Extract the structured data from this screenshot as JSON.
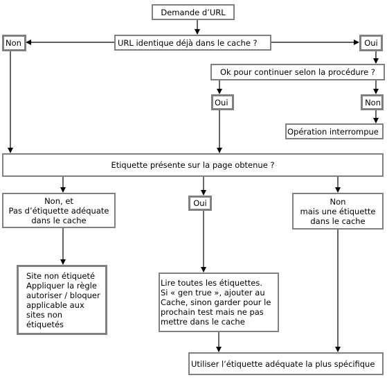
{
  "diagram": {
    "nodes": {
      "start": {
        "label": "Demande d’URL"
      },
      "cache_check": {
        "label": "URL identique déjà dans le cache ?"
      },
      "cache_no": {
        "label": "Non"
      },
      "cache_yes": {
        "label": "Oui"
      },
      "proceed_check": {
        "label": "Ok pour continuer selon la procédure ?"
      },
      "proceed_yes": {
        "label": "Oui"
      },
      "proceed_no": {
        "label": "Non"
      },
      "interrupted": {
        "label": "Opération interrompue"
      },
      "label_present": {
        "label": "Etiquette présente sur la page obtenue ?"
      },
      "no_label_no_cache": {
        "label": "Non, et\nPas d’étiquette adéquate\ndans le cache"
      },
      "label_yes": {
        "label": "Oui"
      },
      "no_but_cache": {
        "label": "Non\nmais une étiquette\ndans le cache"
      },
      "unlabeled_site": {
        "label": "Site non  étiqueté\nAppliquer la règle\nautoriser / bloquer\napplicable aux\nsites non\nétiquetés"
      },
      "read_labels": {
        "label": "Lire toutes les étiquettes.\nSi « gen true », ajouter au\nCache, sinon garder pour le\nprochain test mais ne pas\nmettre dans le cache"
      },
      "use_specific": {
        "label": "Utiliser l’étiquette adéquate la plus spécifique"
      }
    },
    "edges": [
      {
        "from": "start",
        "to": "cache_check"
      },
      {
        "from": "cache_check",
        "to": "cache_no"
      },
      {
        "from": "cache_check",
        "to": "cache_yes"
      },
      {
        "from": "cache_yes",
        "to": "proceed_check"
      },
      {
        "from": "proceed_check",
        "to": "proceed_yes"
      },
      {
        "from": "proceed_check",
        "to": "proceed_no"
      },
      {
        "from": "proceed_no",
        "to": "interrupted"
      },
      {
        "from": "cache_no",
        "to": "label_present"
      },
      {
        "from": "proceed_yes",
        "to": "label_present"
      },
      {
        "from": "label_present",
        "to": "no_label_no_cache"
      },
      {
        "from": "label_present",
        "to": "label_yes"
      },
      {
        "from": "label_present",
        "to": "no_but_cache"
      },
      {
        "from": "no_label_no_cache",
        "to": "unlabeled_site"
      },
      {
        "from": "label_yes",
        "to": "read_labels"
      },
      {
        "from": "read_labels",
        "to": "use_specific"
      },
      {
        "from": "no_but_cache",
        "to": "use_specific"
      }
    ],
    "colors": {
      "box_border": "#808080",
      "line": "#000000",
      "background": "#ffffff"
    }
  }
}
